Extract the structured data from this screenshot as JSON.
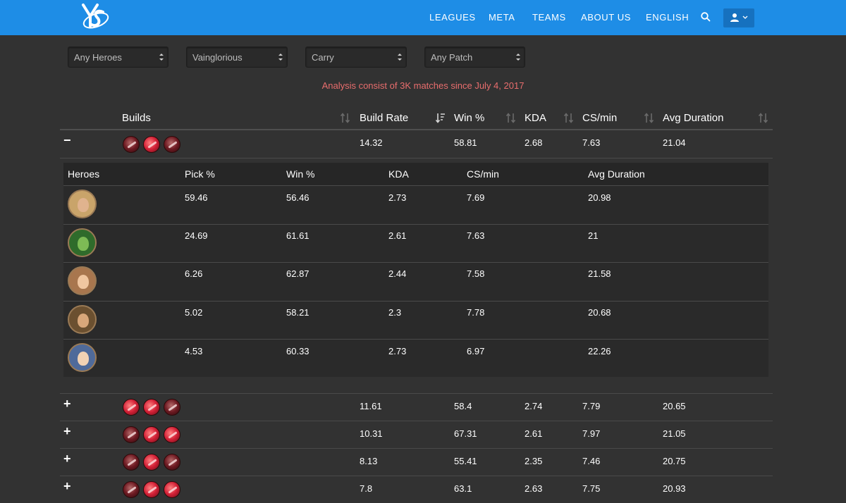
{
  "nav": {
    "links": [
      "LEAGUES",
      "META",
      "TEAMS",
      "ABOUT US",
      "ENGLISH"
    ]
  },
  "filters": [
    "Any Heroes",
    "Vainglorious",
    "Carry",
    "Any Patch"
  ],
  "notice": "Analysis consist of 3K matches since July 4, 2017",
  "table": {
    "headers": [
      "Builds",
      "Build Rate",
      "Win %",
      "KDA",
      "CS/min",
      "Avg Duration"
    ],
    "rows": [
      {
        "toggle": "−",
        "build_rate": "14.32",
        "win": "58.81",
        "kda": "2.68",
        "cs": "7.63",
        "duration": "21.04",
        "items": [
          "dark",
          "blade",
          "dark"
        ]
      },
      {
        "toggle": "+",
        "build_rate": "11.61",
        "win": "58.4",
        "kda": "2.74",
        "cs": "7.79",
        "duration": "20.65",
        "items": [
          "blade",
          "blade",
          "dark"
        ]
      },
      {
        "toggle": "+",
        "build_rate": "10.31",
        "win": "67.31",
        "kda": "2.61",
        "cs": "7.97",
        "duration": "21.05",
        "items": [
          "dark",
          "blade",
          "blade"
        ]
      },
      {
        "toggle": "+",
        "build_rate": "8.13",
        "win": "55.41",
        "kda": "2.35",
        "cs": "7.46",
        "duration": "20.75",
        "items": [
          "dark",
          "blade",
          "dark"
        ]
      },
      {
        "toggle": "+",
        "build_rate": "7.8",
        "win": "63.1",
        "kda": "2.63",
        "cs": "7.75",
        "duration": "20.93",
        "items": [
          "dark",
          "blade",
          "blade"
        ]
      }
    ]
  },
  "heroes": {
    "headers": [
      "Heroes",
      "Pick %",
      "Win %",
      "KDA",
      "CS/min",
      "Avg Duration"
    ],
    "rows": [
      {
        "pick": "59.46",
        "win": "56.46",
        "kda": "2.73",
        "cs": "7.69",
        "duration": "20.98",
        "bg": "#c9a46a"
      },
      {
        "pick": "24.69",
        "win": "61.61",
        "kda": "2.61",
        "cs": "7.63",
        "duration": "21",
        "bg": "#2f6b2b"
      },
      {
        "pick": "6.26",
        "win": "62.87",
        "kda": "2.44",
        "cs": "7.58",
        "duration": "21.58",
        "bg": "#a8764e"
      },
      {
        "pick": "5.02",
        "win": "58.21",
        "kda": "2.3",
        "cs": "7.78",
        "duration": "20.68",
        "bg": "#6b5030"
      },
      {
        "pick": "4.53",
        "win": "60.33",
        "kda": "2.73",
        "cs": "6.97",
        "duration": "22.26",
        "bg": "#4f6a9a"
      }
    ]
  },
  "colors": {
    "navbar": "#1e8de6",
    "background": "#323232",
    "notice": "#e86d6d"
  }
}
